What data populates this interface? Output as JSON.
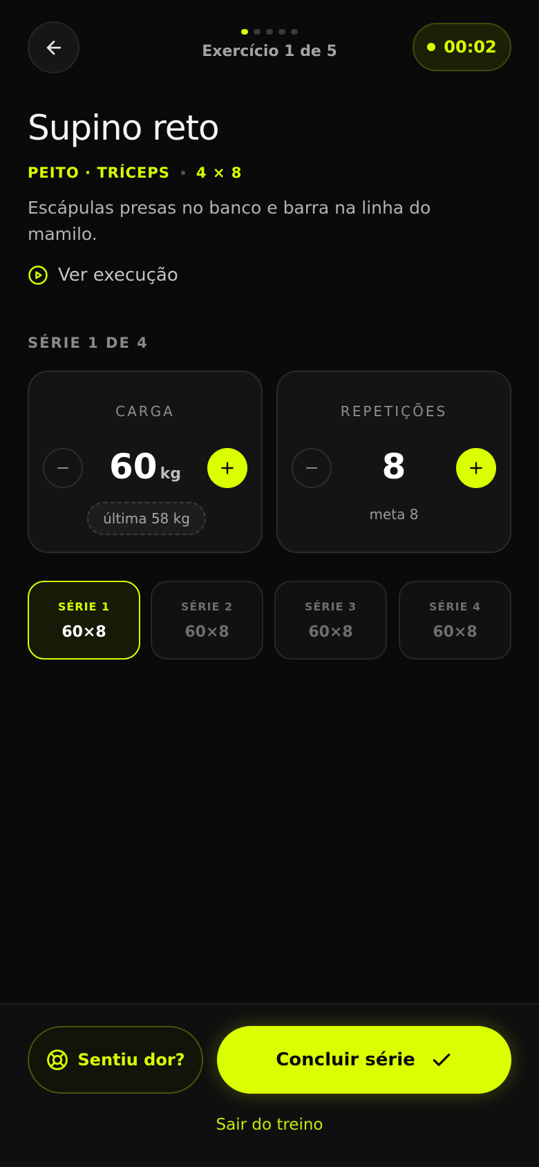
{
  "header": {
    "back_icon": "arrow-left-icon",
    "progress": {
      "total": 5,
      "current": 1
    },
    "exercise_count": "Exercício 1 de 5",
    "timer": "00:02"
  },
  "exercise": {
    "title": "Supino reto",
    "muscles": "PEITO · TRÍCEPS",
    "scheme": "4 × 8",
    "description": "Escápulas presas no banco e barra na linha do mamilo.",
    "watch_label": "Ver execução"
  },
  "set_section": {
    "label": "SÉRIE 1 DE 4",
    "load": {
      "title": "CARGA",
      "value": "60",
      "unit": "kg",
      "last": "última 58 kg"
    },
    "reps": {
      "title": "REPETIÇÕES",
      "value": "8",
      "goal": "meta 8"
    }
  },
  "series": [
    {
      "label": "SÉRIE 1",
      "value": "60×8",
      "active": true
    },
    {
      "label": "SÉRIE 2",
      "value": "60×8",
      "active": false
    },
    {
      "label": "SÉRIE 3",
      "value": "60×8",
      "active": false
    },
    {
      "label": "SÉRIE 4",
      "value": "60×8",
      "active": false
    }
  ],
  "footer": {
    "pain_label": "Sentiu dor?",
    "finish_label": "Concluir série",
    "exit_label": "Sair do treino"
  },
  "colors": {
    "accent": "#d9ff00",
    "background": "#0a0a0a",
    "card": "#141414"
  }
}
